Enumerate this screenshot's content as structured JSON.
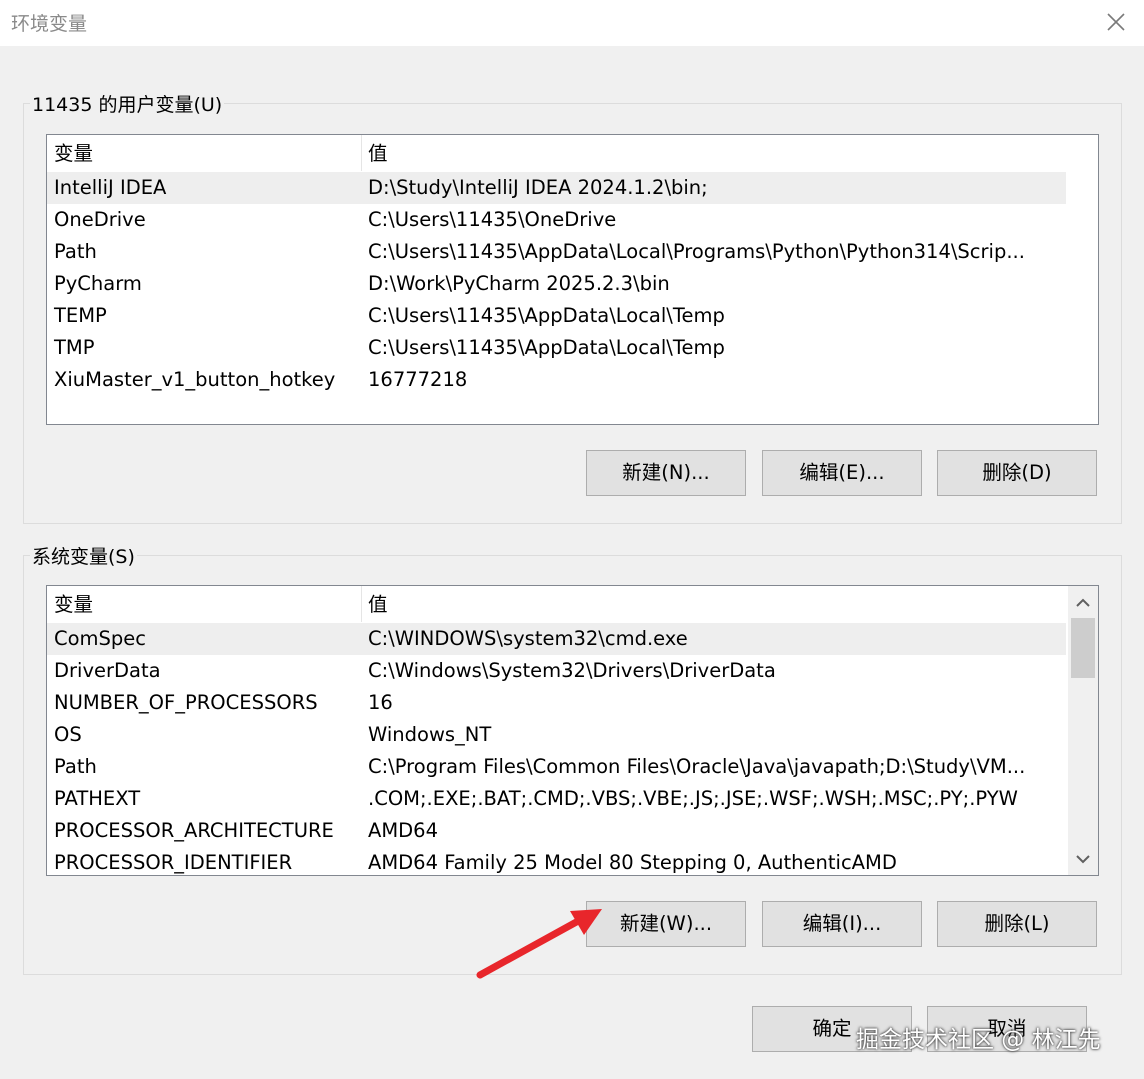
{
  "window": {
    "title": "环境变量"
  },
  "user_vars": {
    "label": "11435 的用户变量(U)",
    "columns": [
      "变量",
      "值"
    ],
    "rows": [
      {
        "name": "IntelliJ IDEA",
        "value": "D:\\Study\\IntelliJ IDEA 2024.1.2\\bin;"
      },
      {
        "name": "OneDrive",
        "value": "C:\\Users\\11435\\OneDrive"
      },
      {
        "name": "Path",
        "value": "C:\\Users\\11435\\AppData\\Local\\Programs\\Python\\Python314\\Scrip..."
      },
      {
        "name": "PyCharm",
        "value": "D:\\Work\\PyCharm 2025.2.3\\bin"
      },
      {
        "name": "TEMP",
        "value": "C:\\Users\\11435\\AppData\\Local\\Temp"
      },
      {
        "name": "TMP",
        "value": "C:\\Users\\11435\\AppData\\Local\\Temp"
      },
      {
        "name": "XiuMaster_v1_button_hotkey",
        "value": "16777218"
      }
    ],
    "selected_index": 0,
    "buttons": {
      "new": "新建(N)...",
      "edit": "编辑(E)...",
      "delete": "删除(D)"
    }
  },
  "system_vars": {
    "label": "系统变量(S)",
    "columns": [
      "变量",
      "值"
    ],
    "rows": [
      {
        "name": "ComSpec",
        "value": "C:\\WINDOWS\\system32\\cmd.exe"
      },
      {
        "name": "DriverData",
        "value": "C:\\Windows\\System32\\Drivers\\DriverData"
      },
      {
        "name": "NUMBER_OF_PROCESSORS",
        "value": "16"
      },
      {
        "name": "OS",
        "value": "Windows_NT"
      },
      {
        "name": "Path",
        "value": "C:\\Program Files\\Common Files\\Oracle\\Java\\javapath;D:\\Study\\VM..."
      },
      {
        "name": "PATHEXT",
        "value": ".COM;.EXE;.BAT;.CMD;.VBS;.VBE;.JS;.JSE;.WSF;.WSH;.MSC;.PY;.PYW"
      },
      {
        "name": "PROCESSOR_ARCHITECTURE",
        "value": "AMD64"
      },
      {
        "name": "PROCESSOR_IDENTIFIER",
        "value": "AMD64 Family 25 Model 80 Stepping 0, AuthenticAMD"
      }
    ],
    "selected_index": 0,
    "buttons": {
      "new": "新建(W)...",
      "edit": "编辑(I)...",
      "delete": "删除(L)"
    }
  },
  "footer": {
    "ok": "确定",
    "cancel": "取消"
  },
  "watermark": "掘金技术社区 @ 林江先",
  "colors": {
    "annotation_arrow": "#e8262b",
    "selection": "#eeeeee"
  }
}
